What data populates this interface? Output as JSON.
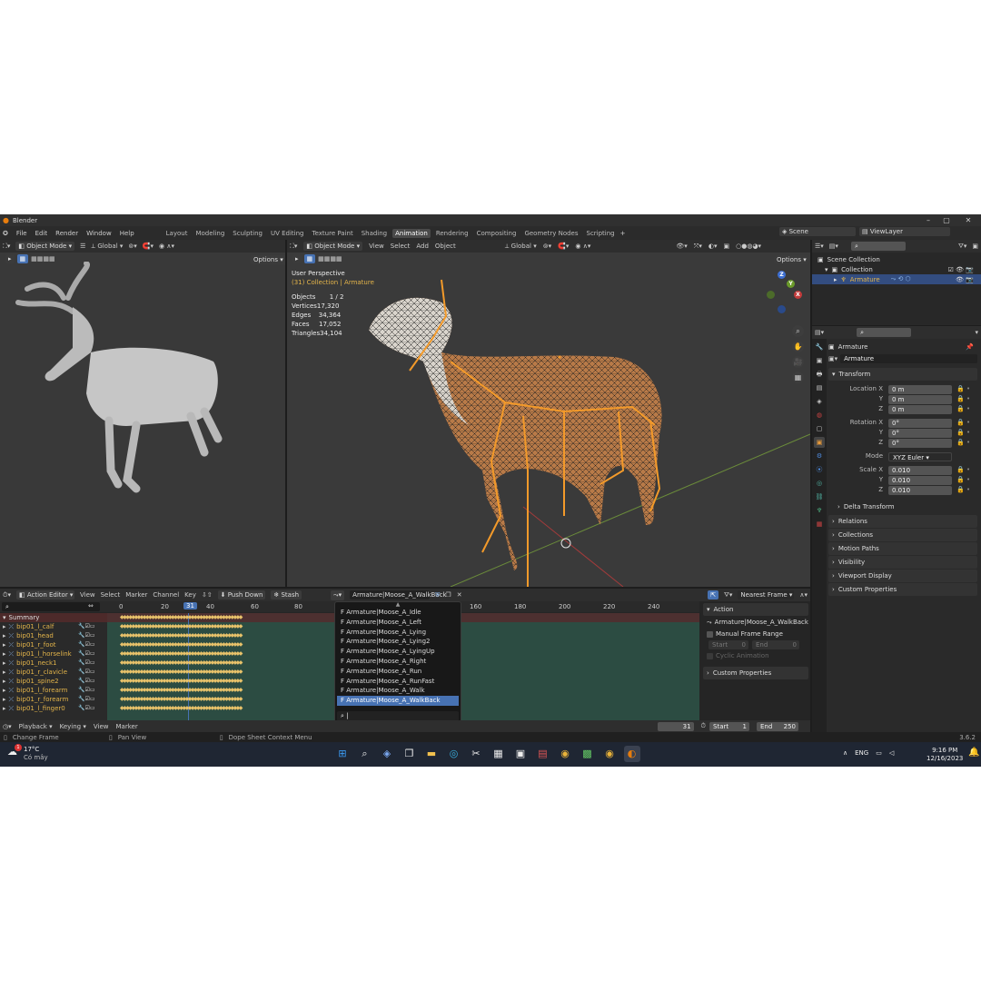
{
  "app": {
    "title": "Blender",
    "version": "3.6.2"
  },
  "menu": [
    "File",
    "Edit",
    "Render",
    "Window",
    "Help"
  ],
  "workspaces": [
    "Layout",
    "Modeling",
    "Sculpting",
    "UV Editing",
    "Texture Paint",
    "Shading",
    "Animation",
    "Rendering",
    "Compositing",
    "Geometry Nodes",
    "Scripting"
  ],
  "active_workspace": "Animation",
  "scene": "Scene",
  "view_layer": "ViewLayer",
  "left_viewport": {
    "mode": "Object Mode",
    "orientation": "Global",
    "options": "Options"
  },
  "main_viewport": {
    "mode": "Object Mode",
    "menus": [
      "View",
      "Select",
      "Add",
      "Object"
    ],
    "orientation": "Global",
    "options": "Options",
    "perspective": "User Perspective",
    "context": "(31) Collection | Armature",
    "stats": [
      {
        "label": "Objects",
        "value": "1 / 2"
      },
      {
        "label": "Vertices",
        "value": "17,320"
      },
      {
        "label": "Edges",
        "value": "34,364"
      },
      {
        "label": "Faces",
        "value": "17,052"
      },
      {
        "label": "Triangles",
        "value": "34,104"
      }
    ],
    "gizmo": {
      "x": "X",
      "y": "Y",
      "z": "Z"
    }
  },
  "outliner": {
    "items": [
      {
        "label": "Scene Collection"
      },
      {
        "label": "Collection"
      },
      {
        "label": "Armature"
      }
    ]
  },
  "properties": {
    "object_name": "Armature",
    "object_field": "Armature",
    "transform_title": "Transform",
    "location": {
      "label": "Location X",
      "x": "0 m",
      "y": "0 m",
      "z": "0 m"
    },
    "rotation": {
      "label": "Rotation X",
      "x": "0°",
      "y": "0°",
      "z": "0°"
    },
    "mode_label": "Mode",
    "mode_value": "XYZ Euler",
    "scale": {
      "label": "Scale X",
      "x": "0.010",
      "y": "0.010",
      "z": "0.010"
    },
    "axis_y": "Y",
    "axis_z": "Z",
    "delta": "Delta Transform",
    "sections": [
      "Relations",
      "Collections",
      "Motion Paths",
      "Visibility",
      "Viewport Display",
      "Custom Properties"
    ]
  },
  "dope_sheet": {
    "editor": "Action Editor",
    "menus": [
      "View",
      "Select",
      "Marker",
      "Channel",
      "Key"
    ],
    "push_down": "Push Down",
    "stash": "Stash",
    "action_name": "Armature|Moose_A_WalkBack",
    "snap": "Nearest Frame",
    "frame_ticks": [
      "0",
      "20",
      "40",
      "60",
      "80",
      "160",
      "180",
      "200",
      "220",
      "240"
    ],
    "current_frame": "31",
    "channels": [
      "Summary",
      "bip01_l_calf",
      "bip01_head",
      "bip01_r_foot",
      "bip01_l_horselink",
      "bip01_neck1",
      "bip01_r_clavicle",
      "bip01_spine2",
      "bip01_l_forearm",
      "bip01_r_forearm",
      "bip01_l_finger0"
    ],
    "action_popup": [
      "F Armature|Moose_A_Idle",
      "F Armature|Moose_A_Left",
      "F Armature|Moose_A_Lying",
      "F Armature|Moose_A_Lying2",
      "F Armature|Moose_A_LyingUp",
      "F Armature|Moose_A_Right",
      "F Armature|Moose_A_Run",
      "F Armature|Moose_A_RunFast",
      "F Armature|Moose_A_Walk",
      "F Armature|Moose_A_WalkBack"
    ],
    "selected_action_index": 9,
    "side_panel": {
      "title": "Action",
      "action": "Armature|Moose_A_WalkBack",
      "manual_range": "Manual Frame Range",
      "start_label": "Start",
      "start_value": "0",
      "end_label": "End",
      "end_value": "0",
      "cyclic": "Cyclic Animation",
      "custom_props": "Custom Properties"
    }
  },
  "timeline": {
    "menus": [
      "Playback",
      "Keying",
      "View",
      "Marker"
    ],
    "frame": "31",
    "start_label": "Start",
    "start": "1",
    "end_label": "End",
    "end": "250"
  },
  "status_bar": {
    "change_frame": "Change Frame",
    "pan_view": "Pan View",
    "context_menu": "Dope Sheet Context Menu"
  },
  "taskbar": {
    "temperature": "17°C",
    "weather": "Có mây",
    "language": "ENG",
    "time": "9:16 PM",
    "date": "12/16/2023",
    "notif_badge": "1"
  }
}
